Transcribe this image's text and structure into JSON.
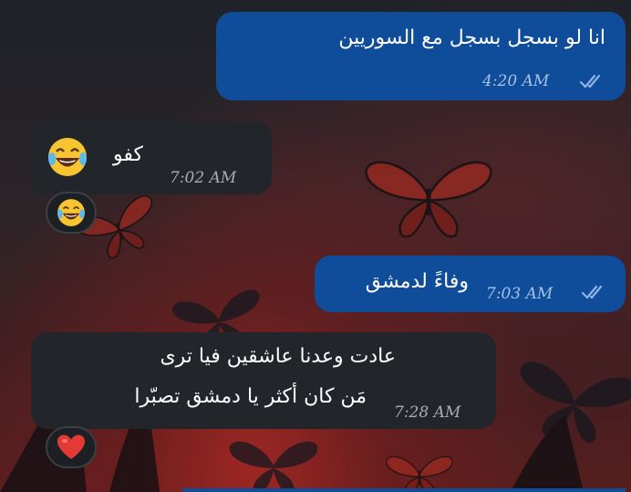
{
  "messages": [
    {
      "id": "m1",
      "direction": "outgoing",
      "text": "انا لو بسجل بسجل مع السوريين",
      "time": "4:20 AM",
      "status": "read"
    },
    {
      "id": "m2",
      "direction": "incoming",
      "text": "كفو",
      "time": "7:02 AM",
      "reaction": "laughing-tears-emoji"
    },
    {
      "id": "m3",
      "direction": "outgoing",
      "text": "وفاءً لدمشق",
      "time": "7:03 AM",
      "status": "read"
    },
    {
      "id": "m4",
      "direction": "incoming",
      "lines": [
        "عادت وعدنا عاشقين فيا ترى",
        "مَن كان أكثر يا دمشق تصبّرا"
      ],
      "time": "7:28 AM",
      "reaction": "red-heart-emoji"
    }
  ],
  "colors": {
    "outgoing_bubble": "#0f4c9a",
    "incoming_bubble": "#22262b",
    "read_ticks": "#8fb4e8"
  }
}
